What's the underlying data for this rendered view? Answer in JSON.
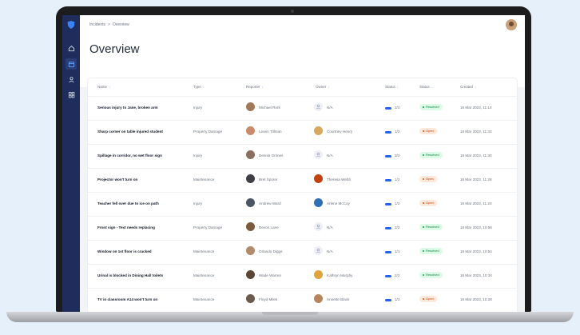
{
  "breadcrumb": {
    "items": [
      "Incidents",
      ">",
      "Overview"
    ]
  },
  "page": {
    "title": "Overview"
  },
  "table": {
    "columns": [
      {
        "label": "Name",
        "arrow": "↓"
      },
      {
        "label": "Type",
        "arrow": "↓"
      },
      {
        "label": "Reporter",
        "arrow": "↓"
      },
      {
        "label": "Owner",
        "arrow": "↓"
      },
      {
        "label": "Status",
        "arrow": "↓"
      },
      {
        "label": "Status",
        "arrow": "↓"
      },
      {
        "label": "Created",
        "arrow": "↓"
      }
    ],
    "rows": [
      {
        "name": "Serious injury to Jane, broken arm",
        "type": "Injury",
        "reporter": "Michael Rork",
        "owner": "N/A",
        "progress": "2/3",
        "status": "Resolved",
        "created": "16 Mar 2023, 11:14"
      },
      {
        "name": "Sharp corner on table injured student",
        "type": "Property Damage",
        "reporter": "Leann Tillman",
        "owner": "Courtney Henry",
        "progress": "1/2",
        "status": "Open",
        "created": "16 Mar 2023, 11:33"
      },
      {
        "name": "Spillage in corridor, no wet floor sign",
        "type": "Injury",
        "reporter": "Dennis Grimes",
        "owner": "N/A",
        "progress": "3/3",
        "status": "Resolved",
        "created": "16 Mar 2023, 11:30"
      },
      {
        "name": "Projector won't turn on",
        "type": "Maintenance",
        "reporter": "Bret Sporer",
        "owner": "Theresa Webb",
        "progress": "1/2",
        "status": "Open",
        "created": "16 Mar 2023, 11:28"
      },
      {
        "name": "Teacher fell over due to ice on path",
        "type": "Injury",
        "reporter": "Andrew Ward",
        "owner": "Arlene McCoy",
        "progress": "1/2",
        "status": "Open",
        "created": "16 Mar 2023, 11:20"
      },
      {
        "name": "Front sign - Text needs replacing",
        "type": "Property Damage",
        "reporter": "Devon Lane",
        "owner": "N/A",
        "progress": "2/2",
        "status": "Resolved",
        "created": "16 Mar 2023, 10:56"
      },
      {
        "name": "Window on 1st floor is cracked",
        "type": "Maintenance",
        "reporter": "Orlando Diggs",
        "owner": "N/A",
        "progress": "1/1",
        "status": "Resolved",
        "created": "16 Mar 2023, 10:54"
      },
      {
        "name": "Urinal is blocked in Dining Hall toilets",
        "type": "Maintenance",
        "reporter": "Wade Warren",
        "owner": "Kathryn Murphy",
        "progress": "2/2",
        "status": "Resolved",
        "created": "16 Mar 2023, 10:34"
      },
      {
        "name": "TV in classroom A14 won't turn on",
        "type": "Maintenance",
        "reporter": "Floyd Miles",
        "owner": "Annette Black",
        "progress": "1/3",
        "status": "Open",
        "created": "16 Mar 2023, 10:28"
      }
    ]
  },
  "icons": {
    "logo": "shield-logo",
    "sidebar": [
      "home-icon",
      "dashboard-icon",
      "users-icon",
      "grid-icon"
    ]
  },
  "colors": {
    "sidebar": "#1e2d5c",
    "accent": "#2563eb",
    "resolved_bg": "#dcfce7",
    "resolved_text": "#15803d",
    "open_bg": "#fee8dc",
    "open_text": "#c2410c"
  }
}
